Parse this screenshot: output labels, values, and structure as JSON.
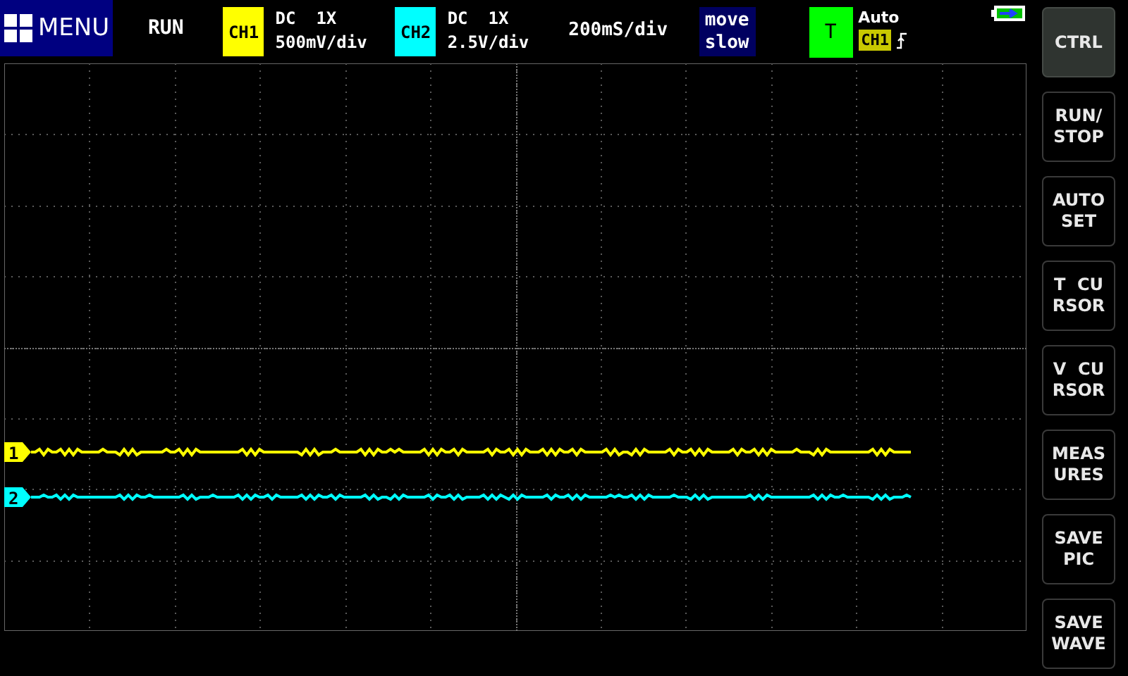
{
  "menu_button": {
    "label": "MENU"
  },
  "run_state": "RUN",
  "channels": [
    {
      "badge": "CH1",
      "color": "#ffff00",
      "coupling": "DC  1X",
      "scale": "500mV/div",
      "marker": "1"
    },
    {
      "badge": "CH2",
      "color": "#00ffff",
      "coupling": "DC  1X",
      "scale": "2.5V/div",
      "marker": "2"
    }
  ],
  "timebase": "200mS/div",
  "move_mode": {
    "line1": "move",
    "line2": "slow"
  },
  "trigger": {
    "label": "T",
    "mode": "Auto",
    "source": "CH1"
  },
  "side_buttons": [
    {
      "lines": [
        "CTRL"
      ],
      "selected": true
    },
    {
      "lines": [
        "RUN/",
        "STOP"
      ],
      "selected": false
    },
    {
      "lines": [
        "AUTO",
        "SET"
      ],
      "selected": false
    },
    {
      "lines": [
        "T  CU",
        "RSOR"
      ],
      "selected": false
    },
    {
      "lines": [
        "V  CU",
        "RSOR"
      ],
      "selected": false
    },
    {
      "lines": [
        "MEAS",
        "URES"
      ],
      "selected": false
    },
    {
      "lines": [
        "SAVE",
        "PIC"
      ],
      "selected": false
    },
    {
      "lines": [
        "SAVE",
        "WAVE"
      ],
      "selected": false
    }
  ]
}
